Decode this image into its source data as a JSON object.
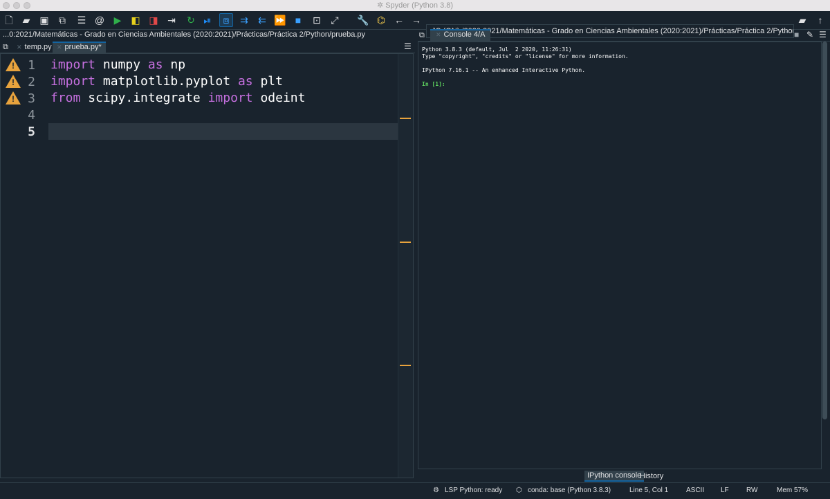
{
  "window": {
    "title": "Spyder (Python 3.8)"
  },
  "toolbar": {
    "path": ":JC (ON) /2020:2021/Matemáticas - Grado en Ciencias Ambientales (2020:2021)/Prácticas/Práctica 2/Python",
    "icons": [
      "new-file-icon",
      "open-folder-icon",
      "save-icon",
      "save-all-icon",
      "list-icon",
      "at-icon",
      "run-icon",
      "run-cell-icon",
      "run-cell-advance-icon",
      "run-selection-icon",
      "rerun-icon",
      "debug-step-icon",
      "debug-icon",
      "step-into-icon",
      "step-return-icon",
      "continue-icon",
      "stop-debug-icon",
      "maximize-pane-icon",
      "fullscreen-icon",
      "wrench-icon",
      "python-path-icon",
      "back-arrow-icon",
      "forward-arrow-icon",
      "browse-folder-icon",
      "parent-dir-icon"
    ]
  },
  "editor": {
    "file_path": "...0:2021/Matemáticas - Grado en Ciencias Ambientales (2020:2021)/Prácticas/Práctica 2/Python/prueba.py",
    "tabs": [
      {
        "label": "temp.py"
      },
      {
        "label": "prueba.py*"
      }
    ],
    "lines": [
      {
        "num": "1",
        "warning": true,
        "tokens": [
          {
            "t": "import",
            "k": true
          },
          {
            "t": " numpy ",
            "k": false
          },
          {
            "t": "as",
            "k": true
          },
          {
            "t": " np",
            "k": false
          }
        ]
      },
      {
        "num": "2",
        "warning": true,
        "tokens": [
          {
            "t": "import",
            "k": true
          },
          {
            "t": " matplotlib.pyplot ",
            "k": false
          },
          {
            "t": "as",
            "k": true
          },
          {
            "t": " plt",
            "k": false
          }
        ]
      },
      {
        "num": "3",
        "warning": true,
        "tokens": [
          {
            "t": "from",
            "k": true
          },
          {
            "t": " scipy.integrate ",
            "k": false
          },
          {
            "t": "import",
            "k": true
          },
          {
            "t": " odeint",
            "k": false
          }
        ]
      },
      {
        "num": "4",
        "warning": false,
        "tokens": []
      },
      {
        "num": "5",
        "warning": false,
        "current": true,
        "tokens": []
      }
    ],
    "warning_glyph": "!"
  },
  "console": {
    "tab_label": "Console 4/A",
    "lines": [
      "Python 3.8.3 (default, Jul  2 2020, 11:26:31)",
      "Type \"copyright\", \"credits\" or \"license\" for more information.",
      "",
      "IPython 7.16.1 -- An enhanced Interactive Python.",
      "",
      ""
    ],
    "prompt": "In [1]:"
  },
  "bottom_tabs": [
    {
      "label": "IPython console"
    },
    {
      "label": "History"
    }
  ],
  "status": {
    "lsp": "LSP Python: ready",
    "conda": "conda: base (Python 3.8.3)",
    "position": "Line 5, Col 1",
    "encoding": "ASCII",
    "eol": "LF",
    "rw": "RW",
    "mem": "Mem 57%"
  }
}
